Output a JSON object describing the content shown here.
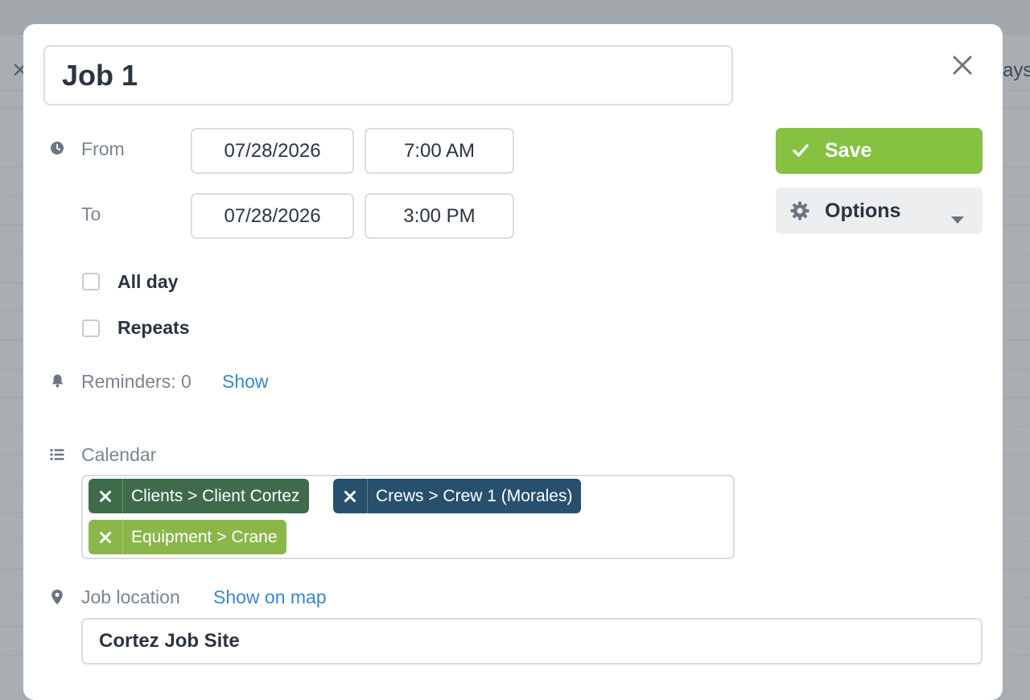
{
  "background": {
    "days_fragment": "ays"
  },
  "modal": {
    "title_value": "Job 1",
    "from": {
      "label": "From",
      "date": "07/28/2026",
      "time": "7:00 AM"
    },
    "to": {
      "label": "To",
      "date": "07/28/2026",
      "time": "3:00 PM"
    },
    "all_day_label": "All day",
    "repeats_label": "Repeats",
    "reminders": {
      "label": "Reminders: 0",
      "link": "Show"
    },
    "calendar": {
      "label": "Calendar",
      "tags": [
        {
          "label": "Clients > Client Cortez",
          "color": "#3f6b4b"
        },
        {
          "label": "Crews > Crew 1 (Morales)",
          "color": "#27506f"
        },
        {
          "label": "Equipment > Crane",
          "color": "#8bb64a"
        }
      ]
    },
    "location": {
      "label": "Job location",
      "link": "Show on map",
      "value": "Cortez Job Site"
    },
    "save_label": "Save",
    "options_label": "Options"
  },
  "colors": {
    "accent_green": "#86c142",
    "link_blue": "#3a87c8",
    "overlay_gray": "#a9aeb3"
  },
  "icons": {
    "close": "close-icon",
    "clock": "clock-icon",
    "bell": "bell-icon",
    "list": "list-icon",
    "pin": "map-pin-icon",
    "check": "check-icon",
    "gear": "gear-icon",
    "caret": "caret-down-icon"
  }
}
